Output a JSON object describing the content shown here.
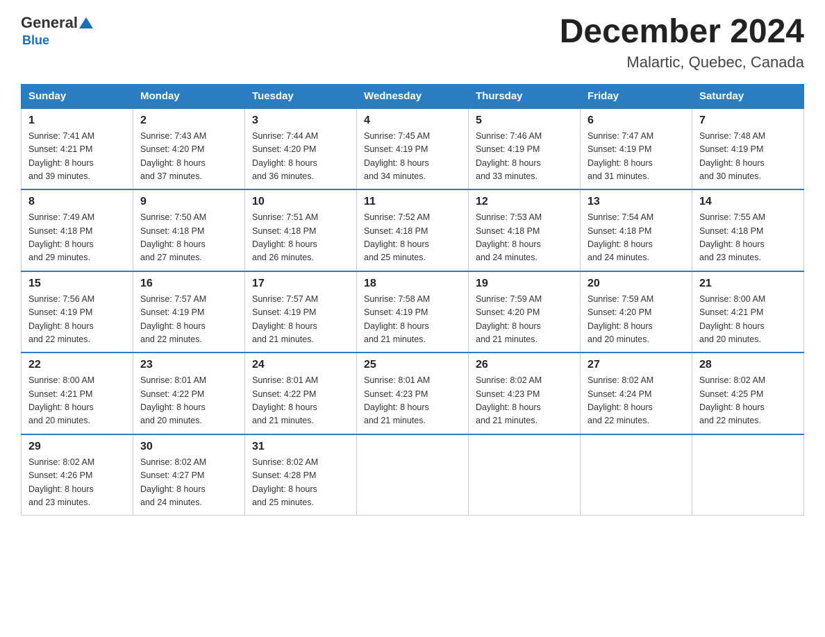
{
  "header": {
    "logo_general": "General",
    "logo_blue": "Blue",
    "month_year": "December 2024",
    "location": "Malartic, Quebec, Canada"
  },
  "days_of_week": [
    "Sunday",
    "Monday",
    "Tuesday",
    "Wednesday",
    "Thursday",
    "Friday",
    "Saturday"
  ],
  "weeks": [
    [
      {
        "num": "1",
        "sunrise": "7:41 AM",
        "sunset": "4:21 PM",
        "daylight": "8 hours and 39 minutes."
      },
      {
        "num": "2",
        "sunrise": "7:43 AM",
        "sunset": "4:20 PM",
        "daylight": "8 hours and 37 minutes."
      },
      {
        "num": "3",
        "sunrise": "7:44 AM",
        "sunset": "4:20 PM",
        "daylight": "8 hours and 36 minutes."
      },
      {
        "num": "4",
        "sunrise": "7:45 AM",
        "sunset": "4:19 PM",
        "daylight": "8 hours and 34 minutes."
      },
      {
        "num": "5",
        "sunrise": "7:46 AM",
        "sunset": "4:19 PM",
        "daylight": "8 hours and 33 minutes."
      },
      {
        "num": "6",
        "sunrise": "7:47 AM",
        "sunset": "4:19 PM",
        "daylight": "8 hours and 31 minutes."
      },
      {
        "num": "7",
        "sunrise": "7:48 AM",
        "sunset": "4:19 PM",
        "daylight": "8 hours and 30 minutes."
      }
    ],
    [
      {
        "num": "8",
        "sunrise": "7:49 AM",
        "sunset": "4:18 PM",
        "daylight": "8 hours and 29 minutes."
      },
      {
        "num": "9",
        "sunrise": "7:50 AM",
        "sunset": "4:18 PM",
        "daylight": "8 hours and 27 minutes."
      },
      {
        "num": "10",
        "sunrise": "7:51 AM",
        "sunset": "4:18 PM",
        "daylight": "8 hours and 26 minutes."
      },
      {
        "num": "11",
        "sunrise": "7:52 AM",
        "sunset": "4:18 PM",
        "daylight": "8 hours and 25 minutes."
      },
      {
        "num": "12",
        "sunrise": "7:53 AM",
        "sunset": "4:18 PM",
        "daylight": "8 hours and 24 minutes."
      },
      {
        "num": "13",
        "sunrise": "7:54 AM",
        "sunset": "4:18 PM",
        "daylight": "8 hours and 24 minutes."
      },
      {
        "num": "14",
        "sunrise": "7:55 AM",
        "sunset": "4:18 PM",
        "daylight": "8 hours and 23 minutes."
      }
    ],
    [
      {
        "num": "15",
        "sunrise": "7:56 AM",
        "sunset": "4:19 PM",
        "daylight": "8 hours and 22 minutes."
      },
      {
        "num": "16",
        "sunrise": "7:57 AM",
        "sunset": "4:19 PM",
        "daylight": "8 hours and 22 minutes."
      },
      {
        "num": "17",
        "sunrise": "7:57 AM",
        "sunset": "4:19 PM",
        "daylight": "8 hours and 21 minutes."
      },
      {
        "num": "18",
        "sunrise": "7:58 AM",
        "sunset": "4:19 PM",
        "daylight": "8 hours and 21 minutes."
      },
      {
        "num": "19",
        "sunrise": "7:59 AM",
        "sunset": "4:20 PM",
        "daylight": "8 hours and 21 minutes."
      },
      {
        "num": "20",
        "sunrise": "7:59 AM",
        "sunset": "4:20 PM",
        "daylight": "8 hours and 20 minutes."
      },
      {
        "num": "21",
        "sunrise": "8:00 AM",
        "sunset": "4:21 PM",
        "daylight": "8 hours and 20 minutes."
      }
    ],
    [
      {
        "num": "22",
        "sunrise": "8:00 AM",
        "sunset": "4:21 PM",
        "daylight": "8 hours and 20 minutes."
      },
      {
        "num": "23",
        "sunrise": "8:01 AM",
        "sunset": "4:22 PM",
        "daylight": "8 hours and 20 minutes."
      },
      {
        "num": "24",
        "sunrise": "8:01 AM",
        "sunset": "4:22 PM",
        "daylight": "8 hours and 21 minutes."
      },
      {
        "num": "25",
        "sunrise": "8:01 AM",
        "sunset": "4:23 PM",
        "daylight": "8 hours and 21 minutes."
      },
      {
        "num": "26",
        "sunrise": "8:02 AM",
        "sunset": "4:23 PM",
        "daylight": "8 hours and 21 minutes."
      },
      {
        "num": "27",
        "sunrise": "8:02 AM",
        "sunset": "4:24 PM",
        "daylight": "8 hours and 22 minutes."
      },
      {
        "num": "28",
        "sunrise": "8:02 AM",
        "sunset": "4:25 PM",
        "daylight": "8 hours and 22 minutes."
      }
    ],
    [
      {
        "num": "29",
        "sunrise": "8:02 AM",
        "sunset": "4:26 PM",
        "daylight": "8 hours and 23 minutes."
      },
      {
        "num": "30",
        "sunrise": "8:02 AM",
        "sunset": "4:27 PM",
        "daylight": "8 hours and 24 minutes."
      },
      {
        "num": "31",
        "sunrise": "8:02 AM",
        "sunset": "4:28 PM",
        "daylight": "8 hours and 25 minutes."
      },
      null,
      null,
      null,
      null
    ]
  ],
  "labels": {
    "sunrise": "Sunrise:",
    "sunset": "Sunset:",
    "daylight": "Daylight:"
  }
}
